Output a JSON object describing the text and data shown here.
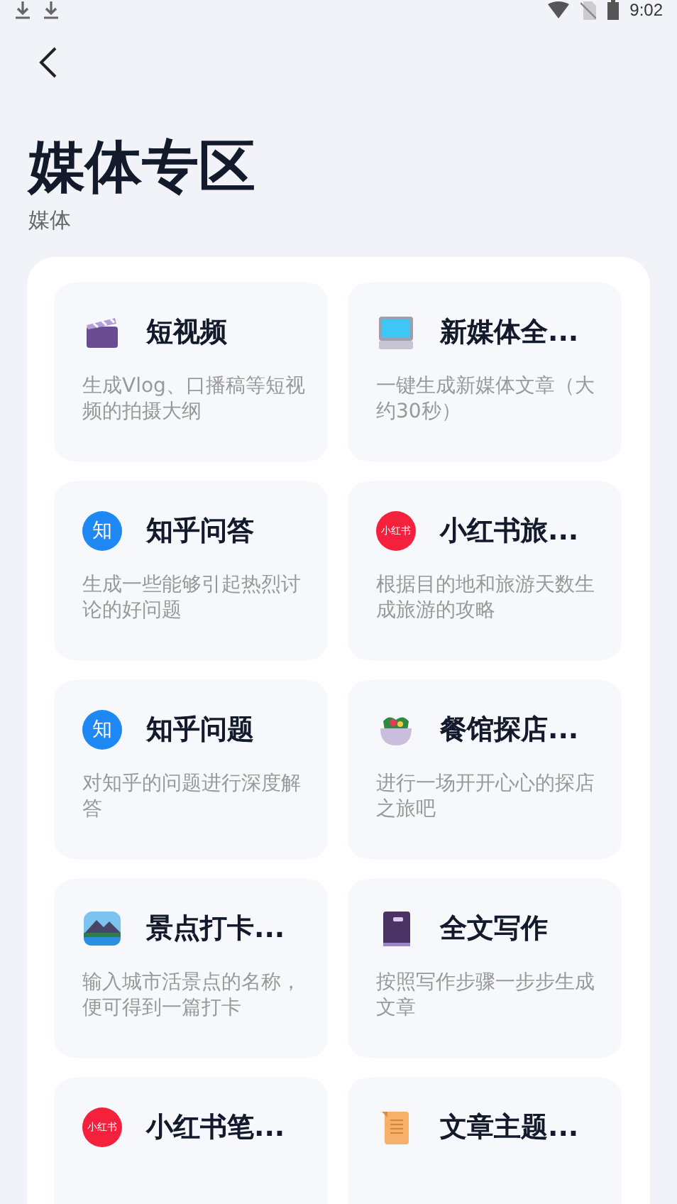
{
  "status_bar": {
    "time": "9:02"
  },
  "header": {
    "title": "媒体专区",
    "subtitle": "媒体"
  },
  "cards": [
    {
      "kind": "clapper",
      "title": "短视频",
      "description": "生成Vlog、口播稿等短视频的拍摄大纲"
    },
    {
      "kind": "monitor",
      "title": "新媒体全...",
      "description": "一键生成新媒体文章（大约30秒）"
    },
    {
      "kind": "zhihu",
      "badge": "知",
      "title": "知乎问答",
      "description": "生成一些能够引起热烈讨论的好问题"
    },
    {
      "kind": "xiaohongshu",
      "badge": "小红书",
      "title": "小红书旅...",
      "description": "根据目的地和旅游天数生成旅游的攻略"
    },
    {
      "kind": "zhihu",
      "badge": "知",
      "title": "知乎问题",
      "description": "对知乎的问题进行深度解答"
    },
    {
      "kind": "salad",
      "title": "餐馆探店...",
      "description": "进行一场开开心心的探店之旅吧"
    },
    {
      "kind": "landscape",
      "title": "景点打卡...",
      "description": "输入城市活景点的名称，便可得到一篇打卡"
    },
    {
      "kind": "book",
      "title": "全文写作",
      "description": "按照写作步骤一步步生成文章"
    },
    {
      "kind": "xiaohongshu",
      "badge": "小红书",
      "title": "小红书笔..."
    },
    {
      "kind": "scroll",
      "title": "文章主题..."
    }
  ]
}
